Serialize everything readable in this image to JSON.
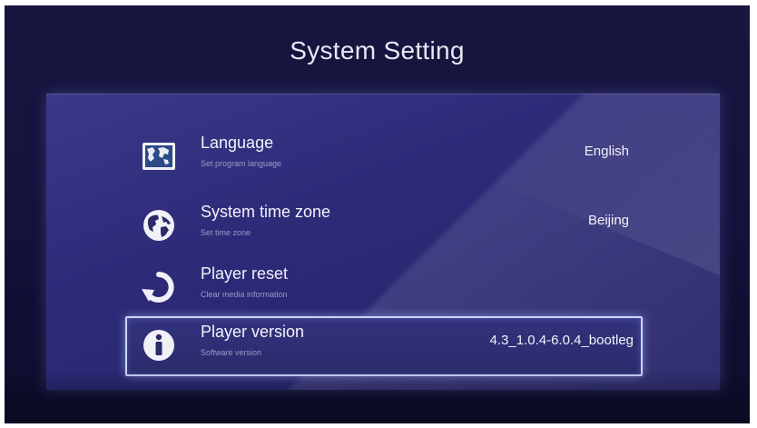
{
  "title": "System Setting",
  "colors": {
    "background": "#12123a",
    "panel": "#2d2b78",
    "selection_border": "#c9d6ff",
    "text": "#f2f2fa",
    "subtext": "#9a9ac8"
  },
  "items": [
    {
      "icon": "map-icon",
      "label": "Language",
      "sub": "Set program language",
      "value": "English",
      "selected": false
    },
    {
      "icon": "globe-icon",
      "label": "System time zone",
      "sub": "Set time zone",
      "value": "Beijing",
      "selected": false
    },
    {
      "icon": "reset-icon",
      "label": "Player reset",
      "sub": "Clear media information",
      "value": "",
      "selected": false
    },
    {
      "icon": "info-icon",
      "label": "Player version",
      "sub": "Software version",
      "value": "4.3_1.0.4-6.0.4_bootleg",
      "selected": true
    }
  ]
}
